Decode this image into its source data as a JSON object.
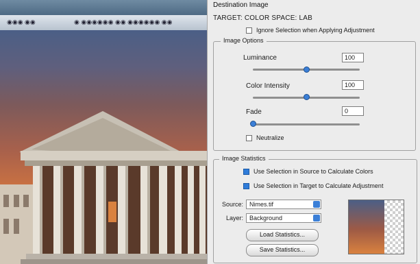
{
  "document": {
    "tab_left": "◉◉◉ ◉◉",
    "tab_right": "◉ ◉◉◉◉◉◉ ◉◉ ◉◉◉◉◉◉ ◉◉"
  },
  "dialog": {
    "section_caption": "Destination Image",
    "target_line": "TARGET: COLOR SPACE: LAB",
    "ignore_selection_label": "Ignore Selection when Applying Adjustment",
    "image_options_title": "Image Options",
    "luminance_label": "Luminance",
    "luminance_value": "100",
    "color_intensity_label": "Color Intensity",
    "color_intensity_value": "100",
    "fade_label": "Fade",
    "fade_value": "0",
    "neutralize_label": "Neutralize",
    "image_statistics_title": "Image Statistics",
    "use_selection_source_label": "Use Selection in Source to Calculate Colors",
    "use_selection_target_label": "Use Selection in Target to Calculate Adjustment",
    "source_label": "Source:",
    "source_value": "Nimes.tif",
    "layer_label": "Layer:",
    "layer_value": "Background",
    "load_stats_button": "Load Statistics...",
    "save_stats_button": "Save Statistics...",
    "accent_color": "#3b7fd7"
  }
}
